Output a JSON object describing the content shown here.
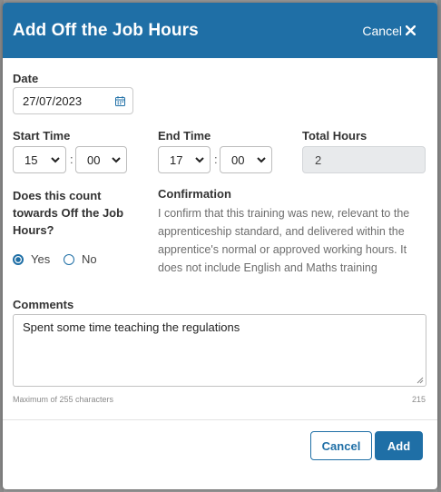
{
  "modal": {
    "title": "Add Off the Job Hours",
    "header_cancel_label": "Cancel"
  },
  "date": {
    "label": "Date",
    "value": "27/07/2023"
  },
  "start_time": {
    "label": "Start Time",
    "hour": "15",
    "minute": "00"
  },
  "end_time": {
    "label": "End Time",
    "hour": "17",
    "minute": "00"
  },
  "total_hours": {
    "label": "Total Hours",
    "value": "2"
  },
  "time_separator": ":",
  "off_job_question": {
    "label": "Does this count towards Off the Job Hours?",
    "options": [
      {
        "label": "Yes",
        "selected": true
      },
      {
        "label": "No",
        "selected": false
      }
    ]
  },
  "confirmation": {
    "label": "Confirmation",
    "text": "I confirm that this training was new, relevant to the apprenticeship standard, and delivered within the apprentice's normal or approved working hours. It does not include English and Maths training"
  },
  "comments": {
    "label": "Comments",
    "value": "Spent some time teaching the regulations",
    "hint": "Maximum of 255 characters",
    "remaining": "215"
  },
  "footer": {
    "cancel_label": "Cancel",
    "add_label": "Add"
  },
  "colors": {
    "primary": "#1f6fa6",
    "readonly_bg": "#e8eaec"
  }
}
